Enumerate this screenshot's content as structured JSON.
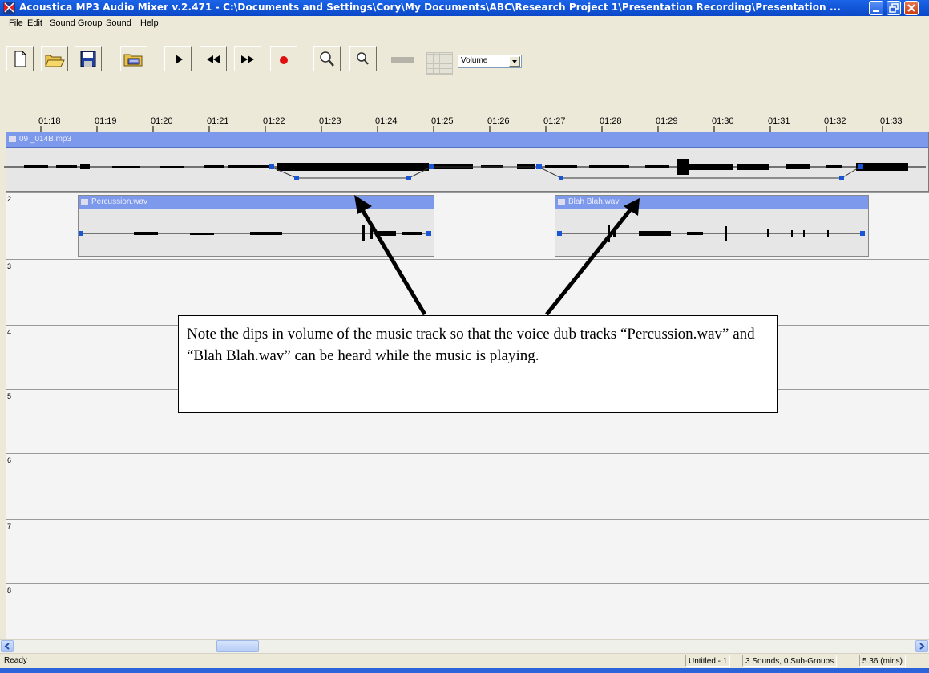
{
  "window": {
    "title": "Acoustica MP3 Audio Mixer v.2.471 - C:\\Documents and Settings\\Cory\\My Documents\\ABC\\Research Project 1\\Presentation Recording\\Presentation ...",
    "controls": [
      "minimize-icon",
      "maximize-icon",
      "close-icon"
    ]
  },
  "menu": [
    "File",
    "Edit",
    "Sound Group",
    "Sound",
    "Help"
  ],
  "toolbar": {
    "buttons": [
      "new-icon",
      "open-icon",
      "save-icon",
      "import-icon",
      "play-icon",
      "rewind-icon",
      "fast-forward-icon",
      "record-icon",
      "zoom-in-icon",
      "zoom-out-icon"
    ],
    "volume_select": "Volume"
  },
  "ruler": {
    "ticks": [
      "01:18",
      "01:19",
      "01:20",
      "01:21",
      "01:22",
      "01:23",
      "01:24",
      "01:25",
      "01:26",
      "01:27",
      "01:28",
      "01:29",
      "01:30",
      "01:31",
      "01:32",
      "01:33"
    ]
  },
  "tracks": {
    "track1": {
      "clip": "09 _014B.mp3"
    },
    "track2": {
      "number": "2",
      "clips": [
        "Percussion.wav",
        "Blah Blah.wav"
      ]
    },
    "lane_numbers": [
      "3",
      "4",
      "5",
      "6",
      "7",
      "8"
    ]
  },
  "annotation": {
    "text": "Note the dips in volume of the music track so that the voice dub tracks “Percussion.wav” and “Blah Blah.wav” can be heard while the music is playing."
  },
  "status": {
    "left": "Ready",
    "document": "Untitled - 1",
    "counts": "3 Sounds, 0 Sub-Groups",
    "length": "5.36 (mins)"
  },
  "colors": {
    "titlebar": "#0b48c8",
    "clip_header": "#7c99ec",
    "envelope_node": "#1a55d6",
    "record": "#e01010"
  }
}
